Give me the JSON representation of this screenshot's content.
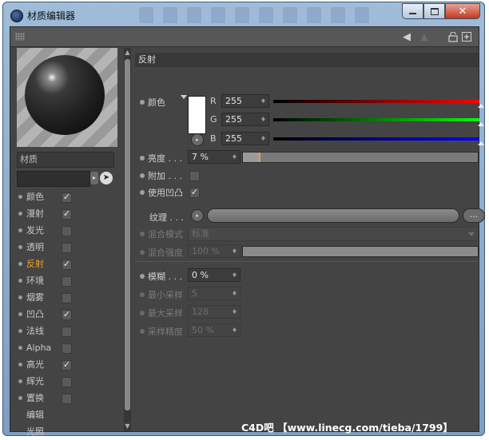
{
  "window": {
    "title": "材质编辑器"
  },
  "toolbar": {
    "icons": [
      "grip-icon",
      "back-arrow-icon",
      "forward-arrow-icon",
      "lock-icon",
      "new-window-icon"
    ]
  },
  "material": {
    "name": "材质"
  },
  "channels": [
    {
      "label": "颜色",
      "checked": true
    },
    {
      "label": "漫射",
      "checked": true
    },
    {
      "label": "发光",
      "checked": false
    },
    {
      "label": "透明",
      "checked": false
    },
    {
      "label": "反射",
      "checked": true,
      "active": true
    },
    {
      "label": "环境",
      "checked": false
    },
    {
      "label": "烟雾",
      "checked": false
    },
    {
      "label": "凹凸",
      "checked": true
    },
    {
      "label": "法线",
      "checked": false
    },
    {
      "label": "Alpha",
      "checked": false
    },
    {
      "label": "高光",
      "checked": true
    },
    {
      "label": "辉光",
      "checked": false
    },
    {
      "label": "置换",
      "checked": false
    },
    {
      "label": "编辑"
    },
    {
      "label": "光照"
    }
  ],
  "section": {
    "title": "反射"
  },
  "color": {
    "label": "颜色",
    "swatch": "#ffffff",
    "r_label": "R",
    "r": "255",
    "g_label": "G",
    "g": "255",
    "b_label": "B",
    "b": "255",
    "r_gradient": [
      "#000000",
      "#ff0000"
    ],
    "g_gradient": [
      "#000000",
      "#00ff00"
    ],
    "b_gradient": [
      "#000000",
      "#0000ff"
    ]
  },
  "brightness": {
    "label": "亮度 . . .",
    "value": "7 %",
    "fraction": 0.07
  },
  "additive": {
    "label": "附加 . . .",
    "checked": false
  },
  "use_bump": {
    "label": "使用凹凸",
    "checked": true
  },
  "texture": {
    "label": "纹理 . . .",
    "more": "..."
  },
  "mix_mode": {
    "label": "混合模式",
    "value": "标准"
  },
  "mix_strength": {
    "label": "混合强度",
    "value": "100 %"
  },
  "blur": {
    "label": "模糊 . . .",
    "value": "0 %"
  },
  "min_samples": {
    "label": "最小采样",
    "value": "5"
  },
  "max_samples": {
    "label": "最大采样",
    "value": "128"
  },
  "sample_accuracy": {
    "label": "采样精度",
    "value": "50 %"
  },
  "watermark": {
    "text": "C4D吧 【www.linecg.com/tieba/1799】"
  }
}
